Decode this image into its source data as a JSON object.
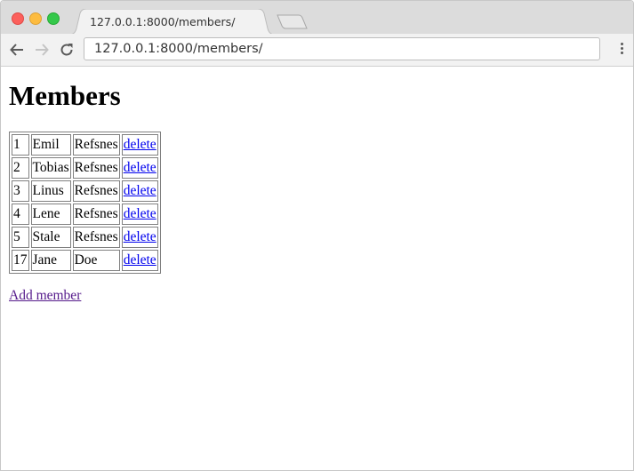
{
  "browser": {
    "tab_title": "127.0.0.1:8000/members/",
    "url": "127.0.0.1:8000/members/"
  },
  "page": {
    "heading": "Members",
    "members": [
      {
        "id": "1",
        "first": "Emil",
        "last": "Refsnes",
        "action": "delete"
      },
      {
        "id": "2",
        "first": "Tobias",
        "last": "Refsnes",
        "action": "delete"
      },
      {
        "id": "3",
        "first": "Linus",
        "last": "Refsnes",
        "action": "delete"
      },
      {
        "id": "4",
        "first": "Lene",
        "last": "Refsnes",
        "action": "delete"
      },
      {
        "id": "5",
        "first": "Stale",
        "last": "Refsnes",
        "action": "delete"
      },
      {
        "id": "17",
        "first": "Jane",
        "last": "Doe",
        "action": "delete"
      }
    ],
    "add_link": "Add member"
  },
  "colors": {
    "link": "#0000ee",
    "visited_link": "#551a8b"
  }
}
